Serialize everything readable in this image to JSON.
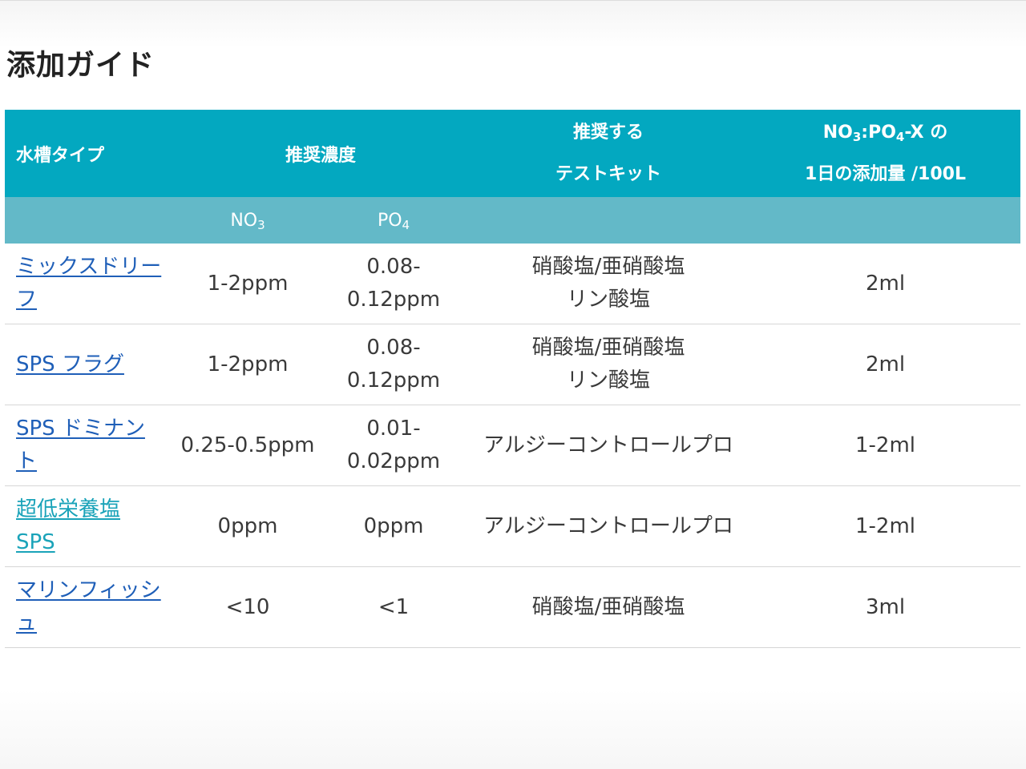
{
  "title": "添加ガイド",
  "table": {
    "headers": {
      "tank_type": "水槽タイプ",
      "recommended_conc": "推奨濃度",
      "test_kit_line1": "推奨する",
      "test_kit_line2": "テストキット",
      "dose_line1_pre": "NO",
      "dose_line1_sub1": "3",
      "dose_line1_mid": ":PO",
      "dose_line1_sub2": "4",
      "dose_line1_post": "-X の",
      "dose_line2": "1日の添加量 /100L"
    },
    "subheaders": {
      "no3_pre": "NO",
      "no3_sub": "3",
      "po4_pre": "PO",
      "po4_sub": "4"
    },
    "rows": [
      {
        "name": "ミックスドリーフ",
        "no3": "1-2ppm",
        "po4": "0.08-0.12ppm",
        "kit_line1": "硝酸塩/亜硝酸塩",
        "kit_line2": "リン酸塩",
        "dose": "2ml"
      },
      {
        "name": "SPS フラグ",
        "no3": "1-2ppm",
        "po4": "0.08-0.12ppm",
        "kit_line1": "硝酸塩/亜硝酸塩",
        "kit_line2": "リン酸塩",
        "dose": "2ml"
      },
      {
        "name": "SPS ドミナント",
        "no3": "0.25-0.5ppm",
        "po4": "0.01-0.02ppm",
        "kit_line1": "アルジーコントロールプロ",
        "kit_line2": "",
        "dose": "1-2ml"
      },
      {
        "name": "超低栄養塩 SPS",
        "no3": "0ppm",
        "po4": "0ppm",
        "kit_line1": "アルジーコントロールプロ",
        "kit_line2": "",
        "dose": "1-2ml"
      },
      {
        "name": "マリンフィッシュ",
        "no3": "<10",
        "po4": "<1",
        "kit_line1": "硝酸塩/亜硝酸塩",
        "kit_line2": "",
        "dose": "3ml"
      }
    ]
  },
  "colors": {
    "header_bg": "#03a8c0",
    "subheader_bg": "#63b9c8",
    "link": "#1f5fb8",
    "visited_link": "#1aa3b9"
  }
}
